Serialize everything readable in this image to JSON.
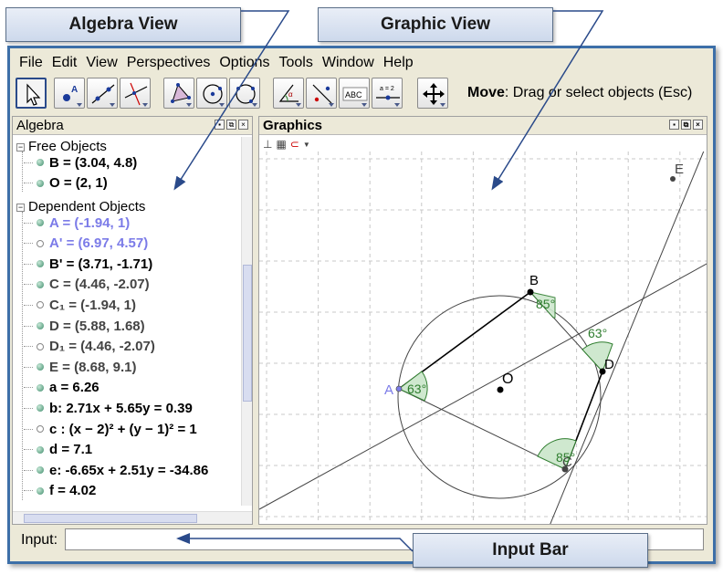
{
  "callouts": {
    "algebra_view": "Algebra View",
    "graphic_view": "Graphic View",
    "input_bar": "Input Bar"
  },
  "menu": [
    "File",
    "Edit",
    "View",
    "Perspectives",
    "Options",
    "Tools",
    "Window",
    "Help"
  ],
  "toolbar": {
    "help_bold": "Move",
    "help_text": ": Drag or select objects (Esc)",
    "text_tool_label": "ABC",
    "slider_tool_label": "a = 2"
  },
  "algebra": {
    "title": "Algebra",
    "free_header": "Free Objects",
    "free": [
      {
        "text": "B = (3.04, 4.8)",
        "color": "#000000"
      },
      {
        "text": "O = (2, 1)",
        "color": "#000000"
      }
    ],
    "dependent_header": "Dependent Objects",
    "dependent": [
      {
        "text": "A = (-1.94, 1)",
        "color": "#7b7be8"
      },
      {
        "text": "A' = (6.97, 4.57)",
        "color": "#7b7be8"
      },
      {
        "text": "B' = (3.71, -1.71)",
        "color": "#000000"
      },
      {
        "text": "C = (4.46, -2.07)",
        "color": "#444444"
      },
      {
        "text": "C₁ = (-1.94, 1)",
        "color": "#444444"
      },
      {
        "text": "D = (5.88, 1.68)",
        "color": "#444444"
      },
      {
        "text": "D₁ = (4.46, -2.07)",
        "color": "#444444"
      },
      {
        "text": "E = (8.68, 9.1)",
        "color": "#444444"
      },
      {
        "text": "a = 6.26",
        "color": "#000000"
      },
      {
        "text": "b: 2.71x + 5.65y = 0.39",
        "color": "#000000"
      },
      {
        "text": "c : (x − 2)² + (y − 1)² = 1",
        "color": "#000000"
      },
      {
        "text": "d = 7.1",
        "color": "#000000"
      },
      {
        "text": "e: -6.65x + 2.51y = -34.86",
        "color": "#000000"
      },
      {
        "text": "f = 4.02",
        "color": "#000000"
      }
    ]
  },
  "graphics": {
    "title": "Graphics",
    "point_labels": {
      "A": "A",
      "B": "B",
      "C": "C",
      "D": "D",
      "E": "E",
      "O": "O"
    },
    "angles": {
      "at_A": "63°",
      "at_B": "85°",
      "at_D": "63°",
      "at_C": "85°"
    },
    "angle_color": "#2e7d2e"
  },
  "input": {
    "label": "Input:",
    "value": ""
  }
}
